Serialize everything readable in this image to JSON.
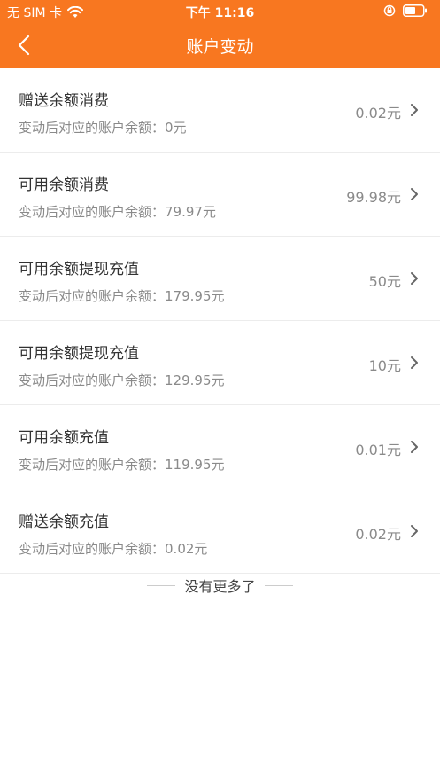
{
  "status_bar": {
    "carrier": "无 SIM 卡",
    "time": "下午 11:16"
  },
  "nav": {
    "title": "账户变动",
    "back_icon": "chevron-left-icon"
  },
  "transactions": [
    {
      "title": "赠送余额消费",
      "balance_label": "变动后对应的账户余额：0元",
      "amount": "0.02元"
    },
    {
      "title": "可用余额消费",
      "balance_label": "变动后对应的账户余额：79.97元",
      "amount": "99.98元"
    },
    {
      "title": "可用余额提现充值",
      "balance_label": "变动后对应的账户余额：179.95元",
      "amount": "50元"
    },
    {
      "title": "可用余额提现充值",
      "balance_label": "变动后对应的账户余额：129.95元",
      "amount": "10元"
    },
    {
      "title": "可用余额充值",
      "balance_label": "变动后对应的账户余额：119.95元",
      "amount": "0.01元"
    },
    {
      "title": "赠送余额充值",
      "balance_label": "变动后对应的账户余额：0.02元",
      "amount": "0.02元"
    }
  ],
  "footer": {
    "end_text": "没有更多了"
  },
  "colors": {
    "accent": "#f87720"
  }
}
